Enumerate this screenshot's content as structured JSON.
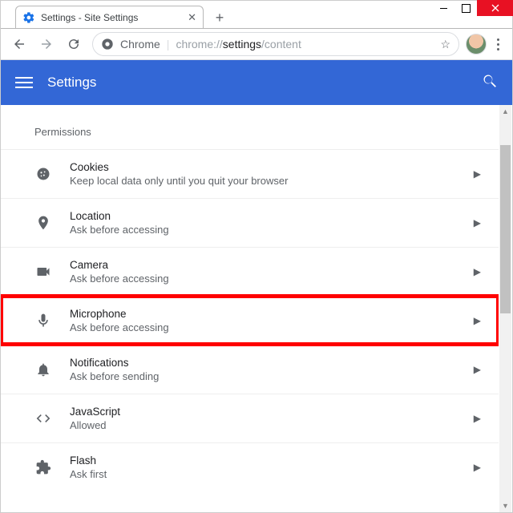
{
  "window": {
    "tab_title": "Settings - Site Settings"
  },
  "omnibox": {
    "scheme_label": "Chrome",
    "url_prefix": "chrome://",
    "url_strong": "settings",
    "url_suffix": "/content"
  },
  "header": {
    "title": "Settings"
  },
  "section": {
    "label": "Permissions",
    "items": [
      {
        "title": "Cookies",
        "sub": "Keep local data only until you quit your browser"
      },
      {
        "title": "Location",
        "sub": "Ask before accessing"
      },
      {
        "title": "Camera",
        "sub": "Ask before accessing"
      },
      {
        "title": "Microphone",
        "sub": "Ask before accessing"
      },
      {
        "title": "Notifications",
        "sub": "Ask before sending"
      },
      {
        "title": "JavaScript",
        "sub": "Allowed"
      },
      {
        "title": "Flash",
        "sub": "Ask first"
      }
    ]
  }
}
